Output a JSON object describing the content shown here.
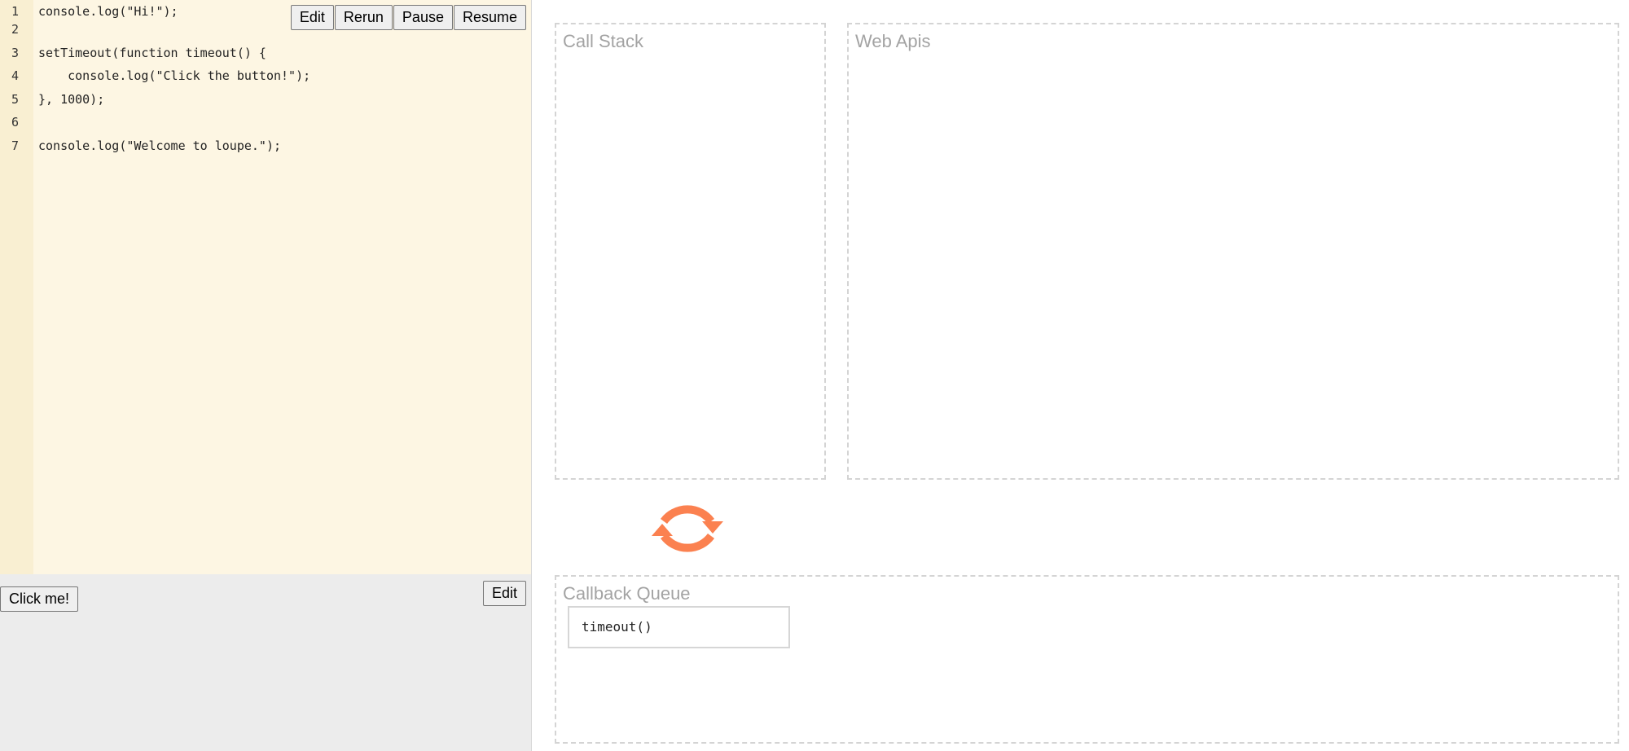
{
  "editor": {
    "lines": [
      {
        "number": "1",
        "text": "console.log(\"Hi!\");"
      },
      {
        "number": "2",
        "text": ""
      },
      {
        "number": "3",
        "text": "setTimeout(function timeout() {"
      },
      {
        "number": "4",
        "text": "    console.log(\"Click the button!\");"
      },
      {
        "number": "5",
        "text": "}, 1000);"
      },
      {
        "number": "6",
        "text": ""
      },
      {
        "number": "7",
        "text": "console.log(\"Welcome to loupe.\");"
      }
    ],
    "toolbar": {
      "edit_label": "Edit",
      "rerun_label": "Rerun",
      "pause_label": "Pause",
      "resume_label": "Resume"
    }
  },
  "output": {
    "click_button_label": "Click me!",
    "edit_label": "Edit"
  },
  "visualizer": {
    "call_stack_title": "Call Stack",
    "web_apis_title": "Web Apis",
    "callback_queue_title": "Callback Queue",
    "callback_queue_items": [
      "timeout()"
    ],
    "event_loop_icon": "refresh-icon",
    "event_loop_color": "#fb8150"
  },
  "colors": {
    "editor_background": "#fdf6e3",
    "gutter_background": "#f9efd2",
    "output_background": "#ececec",
    "box_border": "#d4d4d4",
    "box_title": "#a3a3a3"
  }
}
